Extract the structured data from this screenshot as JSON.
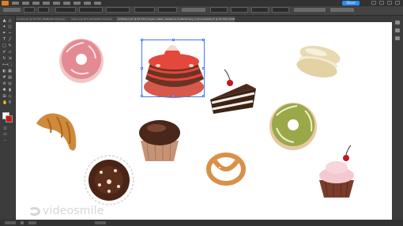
{
  "menu_bar": {
    "app_icon": "illustrator-logo-icon",
    "share_label": "Share",
    "menu_items_count_note": ""
  },
  "tabs": [
    {
      "label": "donuts.ai* @ 33.33% (RGB/GPU Preview)"
    },
    {
      "label": "cake.ai @ 50% (RGB/GPU Preview)"
    },
    {
      "label": "Untitled-1.ai* @ 61.53% (Layer: Cakes, Sweets & Confectionery_2 [Converted].ai* @ 61.53% (RGB/GPU Preview)",
      "active": true
    }
  ],
  "watermark": {
    "text": "videosmile"
  },
  "colors": {
    "selection": "#3d7cf0",
    "stroke_swatch": "#c81818",
    "fill_swatch": "#ffffff",
    "accent_share": "#2e8cf0"
  },
  "canvas_items": [
    {
      "name": "pink-donut",
      "kind": "donut",
      "glaze": "#e48a92"
    },
    {
      "name": "chocolate-cake",
      "kind": "cake",
      "selected": true,
      "highlight": "#e4473c"
    },
    {
      "name": "macaron",
      "kind": "macaron"
    },
    {
      "name": "cake-slice",
      "kind": "slice"
    },
    {
      "name": "green-donut",
      "kind": "donut",
      "glaze": "#9aa84a"
    },
    {
      "name": "croissant",
      "kind": "croissant"
    },
    {
      "name": "chocolate-cupcake",
      "kind": "cupcake"
    },
    {
      "name": "pretzel",
      "kind": "pretzel"
    },
    {
      "name": "cherry-cupcake",
      "kind": "cupcake"
    },
    {
      "name": "chocolate-tart",
      "kind": "tart"
    }
  ]
}
